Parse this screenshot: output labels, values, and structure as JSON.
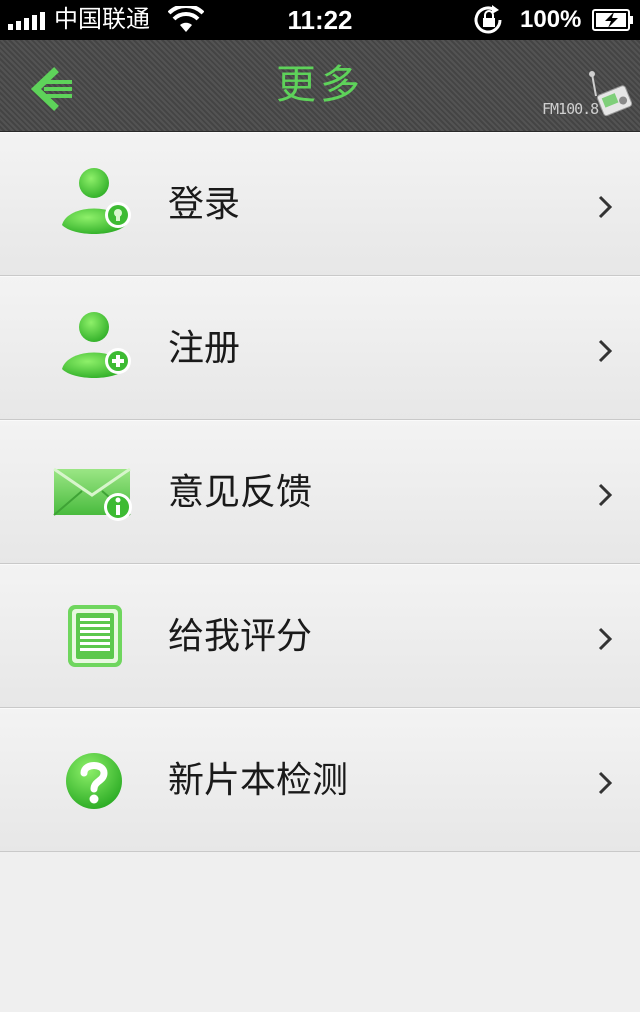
{
  "status_bar": {
    "carrier": "中国联通",
    "time": "11:22",
    "battery": "100%"
  },
  "nav": {
    "title": "更多",
    "brand": "FM100.8"
  },
  "colors": {
    "accent": "#5ed25a",
    "icon_green": "#46c23c"
  },
  "menu": [
    {
      "label": "登录",
      "icon": "user-login-icon"
    },
    {
      "label": "注册",
      "icon": "user-add-icon"
    },
    {
      "label": "意见反馈",
      "icon": "mail-info-icon"
    },
    {
      "label": "给我评分",
      "icon": "document-icon"
    },
    {
      "label": "新片本检测",
      "icon": "question-icon"
    }
  ]
}
